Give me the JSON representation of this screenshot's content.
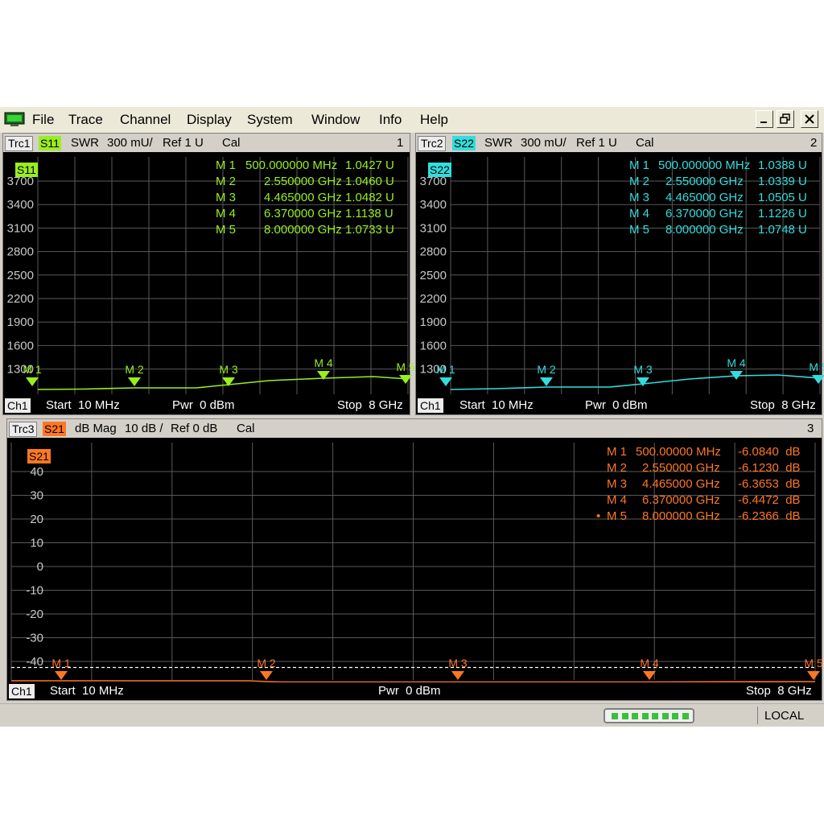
{
  "menu": [
    "File",
    "Trace",
    "Channel",
    "Display",
    "System",
    "Window",
    "Info",
    "Help"
  ],
  "window_controls": {
    "minimize": "_",
    "restore": "❐",
    "close": "✕"
  },
  "panels": [
    {
      "trace": "Trc1",
      "param": "S11",
      "format": "SWR",
      "scale": "300 mU/",
      "ref": "Ref 1 U",
      "cal": "Cal",
      "number": "1",
      "tag": "S11",
      "color": "#99ee22",
      "channel": "Ch1",
      "start": "Start  10 MHz",
      "power": "Pwr  0 dBm",
      "stop": "Stop  8 GHz",
      "y_ticks": [
        "3700",
        "3400",
        "3100",
        "2800",
        "2500",
        "2200",
        "1900",
        "1600",
        "1300"
      ],
      "markers": [
        {
          "name": "M 1",
          "stim": "500.000000 MHz",
          "value": "1.0427 U"
        },
        {
          "name": "M 2",
          "stim": "2.550000 GHz",
          "value": "1.0460 U"
        },
        {
          "name": "M 3",
          "stim": "4.465000 GHz",
          "value": "1.0482 U"
        },
        {
          "name": "M 4",
          "stim": "6.370000 GHz",
          "value": "1.1138 U"
        },
        {
          "name": "M 5",
          "stim": "8.000000 GHz",
          "value": "1.0733 U"
        }
      ]
    },
    {
      "trace": "Trc2",
      "param": "S22",
      "format": "SWR",
      "scale": "300 mU/",
      "ref": "Ref 1 U",
      "cal": "Cal",
      "number": "2",
      "tag": "S22",
      "color": "#33dddd",
      "channel": "Ch1",
      "start": "Start  10 MHz",
      "power": "Pwr  0 dBm",
      "stop": "Stop  8 GHz",
      "y_ticks": [
        "3700",
        "3400",
        "3100",
        "2800",
        "2500",
        "2200",
        "1900",
        "1600",
        "1300"
      ],
      "markers": [
        {
          "name": "M 1",
          "stim": "500.000000 MHz",
          "value": "1.0388 U"
        },
        {
          "name": "M 2",
          "stim": "2.550000 GHz",
          "value": "1.0339 U"
        },
        {
          "name": "M 3",
          "stim": "4.465000 GHz",
          "value": "1.0505 U"
        },
        {
          "name": "M 4",
          "stim": "6.370000 GHz",
          "value": "1.1226 U"
        },
        {
          "name": "M 5",
          "stim": "8.000000 GHz",
          "value": "1.0748 U"
        }
      ]
    },
    {
      "trace": "Trc3",
      "param": "S21",
      "format": "dB Mag",
      "scale": "10 dB /",
      "ref": "Ref 0 dB",
      "cal": "Cal",
      "number": "3",
      "tag": "S21",
      "color": "#ff7722",
      "channel": "Ch1",
      "start": "Start  10 MHz",
      "power": "Pwr  0 dBm",
      "stop": "Stop  8 GHz",
      "y_ticks": [
        "40",
        "30",
        "20",
        "10",
        "0",
        "-10",
        "-20",
        "-30",
        "-40"
      ],
      "active_marker": "•",
      "markers": [
        {
          "name": "M 1",
          "stim": "500.00000 MHz",
          "value": "-6.0840  dB"
        },
        {
          "name": "M 2",
          "stim": "2.550000 GHz",
          "value": "-6.1230  dB"
        },
        {
          "name": "M 3",
          "stim": "4.465000 GHz",
          "value": "-6.3653  dB"
        },
        {
          "name": "M 4",
          "stim": "6.370000 GHz",
          "value": "-6.4472  dB"
        },
        {
          "name": "M 5",
          "stim": "8.000000 GHz",
          "value": "-6.2366  dB"
        }
      ]
    }
  ],
  "status": {
    "remote_state": "LOCAL",
    "indicator_count": 8
  }
}
